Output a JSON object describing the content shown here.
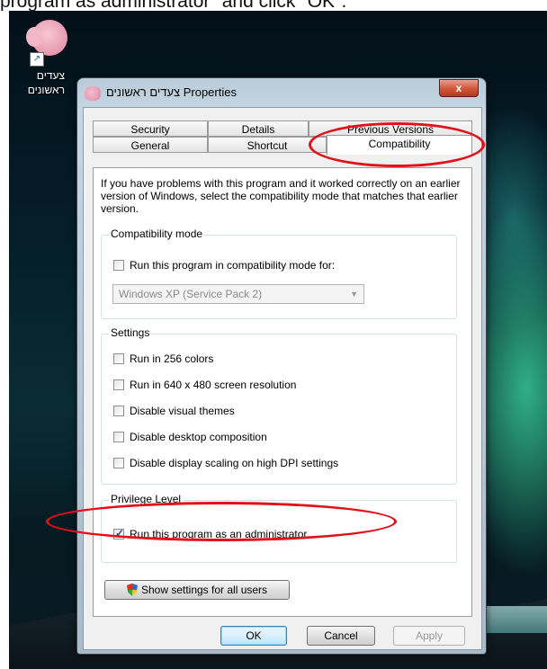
{
  "caption": "program as administrator\" and click \"OK\".",
  "desktop": {
    "icon_label": "צעדים ראשונים"
  },
  "window": {
    "title": "צעדים ראשונים Properties",
    "close_label": "x"
  },
  "tabs": {
    "row1": [
      "Security",
      "Details",
      "Previous Versions"
    ],
    "row2": [
      "General",
      "Shortcut",
      "Compatibility"
    ],
    "active": "Compatibility"
  },
  "intro": "If you have problems with this program and it worked correctly on an earlier version of Windows, select the compatibility mode that matches that earlier version.",
  "compatibility_mode": {
    "title": "Compatibility mode",
    "checkbox_label": "Run this program in compatibility mode for:",
    "checked": false,
    "select_value": "Windows XP (Service Pack 2)"
  },
  "settings": {
    "title": "Settings",
    "items": [
      {
        "label": "Run in 256 colors",
        "checked": false
      },
      {
        "label": "Run in 640 x 480 screen resolution",
        "checked": false
      },
      {
        "label": "Disable visual themes",
        "checked": false
      },
      {
        "label": "Disable desktop composition",
        "checked": false
      },
      {
        "label": "Disable display scaling on high DPI settings",
        "checked": false
      }
    ]
  },
  "privilege": {
    "title": "Privilege Level",
    "label": "Run this program as an administrator",
    "checked": true
  },
  "show_settings_label": "Show settings for all users",
  "buttons": {
    "ok": "OK",
    "cancel": "Cancel",
    "apply": "Apply"
  },
  "colors": {
    "highlight": "#e3101a",
    "accent": "#3c7fb1"
  }
}
